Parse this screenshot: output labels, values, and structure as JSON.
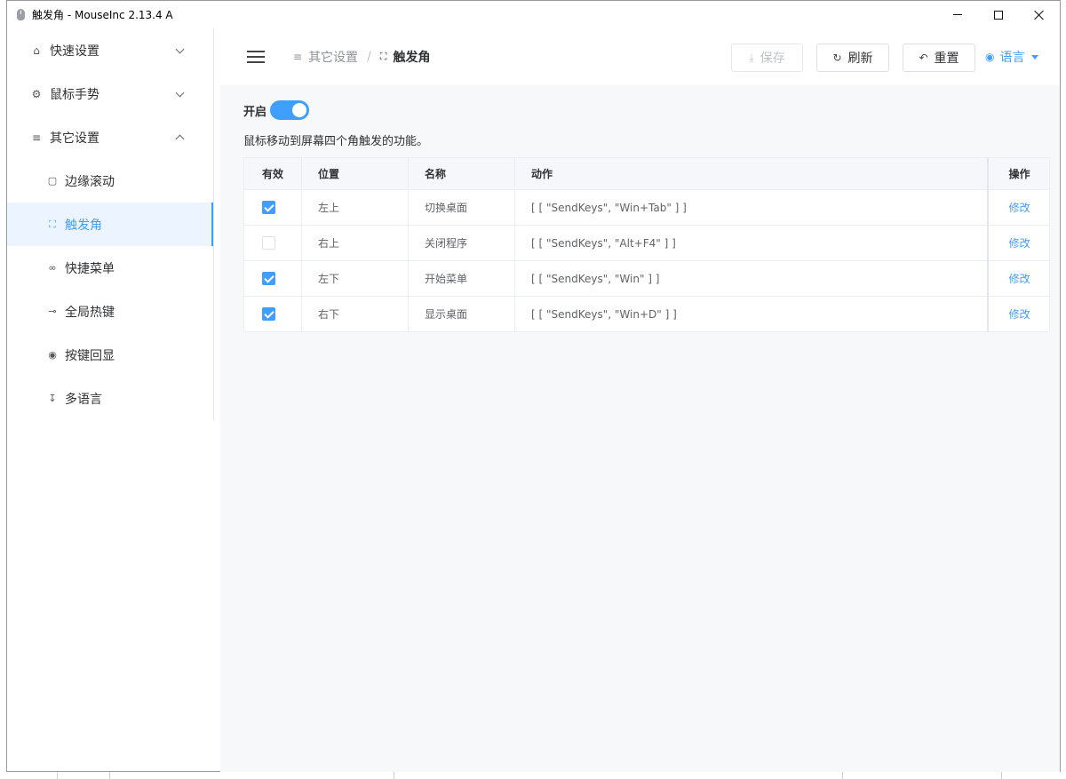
{
  "window": {
    "title": "触发角 - MouseInc 2.13.4 A",
    "controls": {
      "minimize": "minimize-icon",
      "maximize": "maximize-icon",
      "close": "close-icon"
    }
  },
  "sidebar": {
    "groups": [
      {
        "label": "快速设置",
        "icon": "home-icon",
        "expanded": false
      },
      {
        "label": "鼠标手势",
        "icon": "gear-icon",
        "expanded": false
      },
      {
        "label": "其它设置",
        "icon": "sliders-icon",
        "expanded": true
      }
    ],
    "items": [
      {
        "label": "边缘滚动",
        "icon": "monitor-icon"
      },
      {
        "label": "触发角",
        "icon": "corners-icon",
        "active": true
      },
      {
        "label": "快捷菜单",
        "icon": "link-icon"
      },
      {
        "label": "全局热键",
        "icon": "key-icon"
      },
      {
        "label": "按键回显",
        "icon": "eye-icon"
      },
      {
        "label": "多语言",
        "icon": "mic-icon"
      }
    ]
  },
  "header": {
    "breadcrumb": {
      "parent": "其它设置",
      "current": "触发角"
    },
    "buttons": {
      "save": "保存",
      "refresh": "刷新",
      "reset": "重置"
    },
    "language": "语言"
  },
  "main": {
    "toggle_label": "开启",
    "toggle_on": true,
    "description": "鼠标移动到屏幕四个角触发的功能。",
    "table": {
      "headers": [
        "有效",
        "位置",
        "名称",
        "动作",
        "操作"
      ],
      "rows": [
        {
          "enabled": true,
          "position": "左上",
          "name": "切换桌面",
          "action": "[ [ \"SendKeys\", \"Win+Tab\" ] ]",
          "op": "修改"
        },
        {
          "enabled": false,
          "position": "右上",
          "name": "关闭程序",
          "action": "[ [ \"SendKeys\", \"Alt+F4\" ] ]",
          "op": "修改"
        },
        {
          "enabled": true,
          "position": "左下",
          "name": "开始菜单",
          "action": "[ [ \"SendKeys\", \"Win\" ] ]",
          "op": "修改"
        },
        {
          "enabled": true,
          "position": "右下",
          "name": "显示桌面",
          "action": "[ [ \"SendKeys\", \"Win+D\" ] ]",
          "op": "修改"
        }
      ]
    }
  },
  "colors": {
    "accent": "#409eff",
    "active_bg": "#ecf5ff",
    "main_bg": "#f7f8fa"
  }
}
